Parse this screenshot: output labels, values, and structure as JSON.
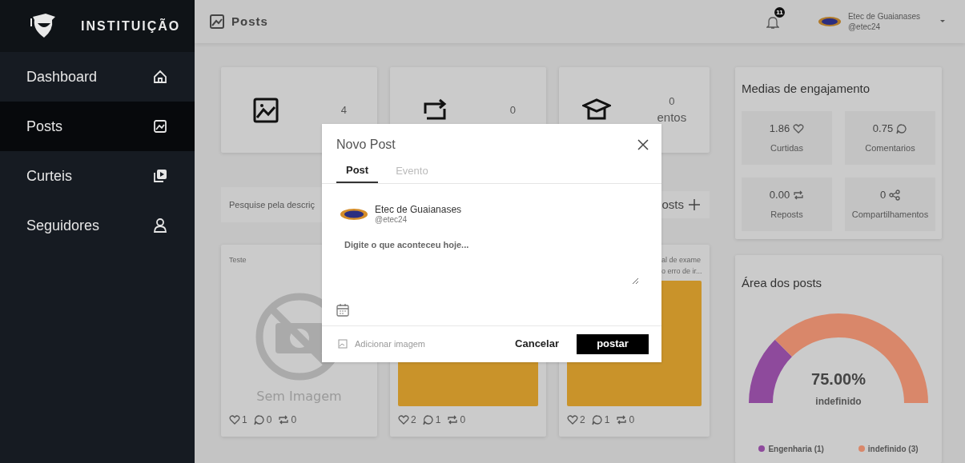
{
  "sidebar": {
    "brand": "INSTITUIÇÃO",
    "items": [
      {
        "label": "Dashboard",
        "kind": "home",
        "selected": false
      },
      {
        "label": "Posts",
        "kind": "image",
        "selected": true
      },
      {
        "label": "Curteis",
        "kind": "video",
        "selected": false
      },
      {
        "label": "Seguidores",
        "kind": "user",
        "selected": false
      }
    ]
  },
  "header": {
    "title": "Posts",
    "notifications": "11",
    "user": {
      "name": "Etec de Guaianases",
      "handle": "@etec24"
    }
  },
  "stats": [
    {
      "kind": "posts",
      "value": "4"
    },
    {
      "kind": "reposts",
      "value": "0"
    },
    {
      "kind": "events",
      "value": "0",
      "label": "entos"
    }
  ],
  "search": {
    "placeholder": "Pesquise pela descriç"
  },
  "new_button": "osts",
  "posts": [
    {
      "text": [
        "Teste"
      ],
      "image": false,
      "no_image_text": "Sem Imagem",
      "stats": [
        {
          "kind": "likes",
          "value": "1"
        },
        {
          "kind": "comments",
          "value": "0"
        },
        {
          "kind": "reposts",
          "value": "0"
        }
      ]
    },
    {
      "image": true,
      "stats": [
        {
          "kind": "likes",
          "value": "2"
        },
        {
          "kind": "comments",
          "value": "1"
        },
        {
          "kind": "reposts",
          "value": "0"
        }
      ]
    },
    {
      "text": [
        "al de exame",
        "o erro de ir..."
      ],
      "image": true,
      "stats": [
        {
          "kind": "likes",
          "value": "2"
        },
        {
          "kind": "comments",
          "value": "1"
        },
        {
          "kind": "reposts",
          "value": "0"
        }
      ]
    }
  ],
  "engagement": {
    "title": "Medias de engajamento",
    "tiles": [
      {
        "kind": "likes",
        "value": "1.86",
        "label": "Curtidas"
      },
      {
        "kind": "comments",
        "value": "0.75",
        "label": "Comentarios"
      },
      {
        "kind": "reposts",
        "value": "0.00",
        "label": "Reposts"
      },
      {
        "kind": "shares",
        "value": "0",
        "label": "Compartilhamentos"
      }
    ]
  },
  "area_chart": {
    "title": "Área dos posts",
    "center_value": "75.00%",
    "center_label": "indefinido",
    "legend": [
      {
        "label": "Engenharia (1)",
        "color": "#8e4a9c"
      },
      {
        "label": "indefinido (3)",
        "color": "#d9876a"
      }
    ],
    "chart_data": {
      "type": "donut",
      "values": [
        25,
        75
      ]
    }
  },
  "modal": {
    "title": "Novo Post",
    "tabs": [
      {
        "label": "Post",
        "selected": true
      },
      {
        "label": "Evento",
        "selected": false
      }
    ],
    "author": {
      "name": "Etec de Guaianases",
      "handle": "@etec24"
    },
    "placeholder": "Digite o que aconteceu hoje...",
    "add_image": "Adicionar imagem",
    "cancel": "Cancelar",
    "submit": "postar"
  }
}
